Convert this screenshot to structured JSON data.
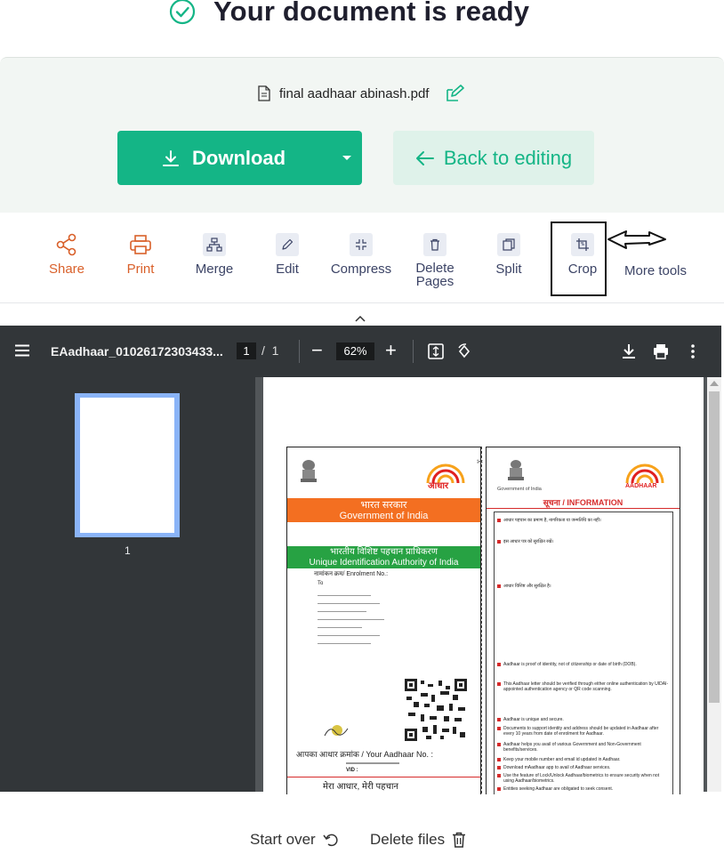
{
  "header": {
    "title": "Your document is ready"
  },
  "file": {
    "name": "final aadhaar abinash.pdf"
  },
  "actions": {
    "download_label": "Download",
    "back_label": "Back to editing"
  },
  "tools": [
    {
      "label": "Share",
      "icon": "share-icon"
    },
    {
      "label": "Print",
      "icon": "printer-icon"
    },
    {
      "label": "Merge",
      "icon": "merge-icon"
    },
    {
      "label": "Edit",
      "icon": "pencil-icon"
    },
    {
      "label": "Compress",
      "icon": "compress-icon"
    },
    {
      "label": "Delete Pages",
      "icon": "trash-icon"
    },
    {
      "label": "Split",
      "icon": "split-icon"
    },
    {
      "label": "Crop",
      "icon": "crop-icon"
    },
    {
      "label": "More tools",
      "icon": ""
    }
  ],
  "viewer": {
    "doc_name": "EAadhaar_01026172303433...",
    "page_current": "1",
    "page_separator": "/",
    "page_total": "1",
    "zoom": "62%",
    "thumbnail_label": "1"
  },
  "aadhaar": {
    "govt_hi": "भारत सरकार",
    "govt_en": "Government of India",
    "uidai_hi": "भारतीय विशिष्ट पहचान प्राधिकरण",
    "uidai_en": "Unique Identification Authority of India",
    "enrolment": "नामांकन क्रम/ Enrolment No.:",
    "to": "To",
    "aadhaar_hi": "आधार",
    "aadhaar_en": "AADHAAR",
    "your_no": "आपका आधार क्रमांक / Your Aadhaar No. :",
    "vid": "VID :",
    "slogan": "मेरा आधार, मेरी पहचान",
    "govt_small": "Government of India",
    "info_title": "सूचना / INFORMATION",
    "info_lines": [
      "आधार पहचान का प्रमाण है, नागरिकता या जन्मतिथि का नहीं।",
      "इस आधार पत्र को सुरक्षित रखें।",
      "आधार विशिष्ट और सुरक्षित है।",
      "Aadhaar is proof of identity, not of citizenship or date of birth (DOB).",
      "This Aadhaar letter should be verified through either online authentication by UIDAI-appointed authentication agency or QR code scanning.",
      "Aadhaar is unique and secure.",
      "Documents to support identity and address should be updated in Aadhaar after every 10 years from date of enrolment for Aadhaar.",
      "Aadhaar helps you avail of various Government and Non-Government benefits/services.",
      "Keep your mobile number and email id updated in Aadhaar.",
      "Download mAadhaar app to avail of Aadhaar services.",
      "Use the feature of Lock/Unlock Aadhaar/biometrics to ensure security when not using Aadhaar/biometrics.",
      "Entities seeking Aadhaar are obligated to seek consent."
    ]
  },
  "footer": {
    "start_over": "Start over",
    "delete_files": "Delete files"
  },
  "colors": {
    "accent": "#14b586",
    "accent_light": "#dff2ea",
    "share_print": "#d9602a",
    "toolbar_dark": "#323639"
  }
}
